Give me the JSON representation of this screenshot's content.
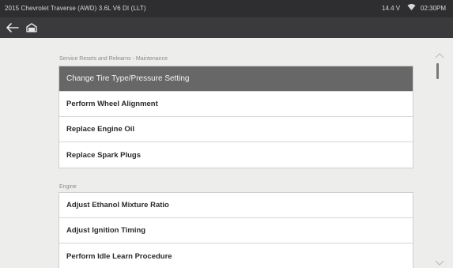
{
  "status_bar": {
    "vehicle": "2015 Chevrolet Traverse (AWD) 3.6L V6 DI (LLT)",
    "voltage": "14.4 V",
    "time": "02:30PM"
  },
  "sections": [
    {
      "header": "Service Resets and Relearns - Maintenance",
      "items": [
        {
          "label": "Change Tire Type/Pressure Setting",
          "selected": true
        },
        {
          "label": "Perform Wheel Alignment",
          "selected": false
        },
        {
          "label": "Replace Engine Oil",
          "selected": false
        },
        {
          "label": "Replace Spark Plugs",
          "selected": false
        }
      ]
    },
    {
      "header": "Engine",
      "items": [
        {
          "label": "Adjust Ethanol Mixture Ratio",
          "selected": false
        },
        {
          "label": "Adjust Ignition Timing",
          "selected": false
        },
        {
          "label": "Perform Idle Learn Procedure",
          "selected": false
        }
      ]
    }
  ],
  "colors": {
    "selected_row": "#676767",
    "background": "#ededeb",
    "status_bar": "#2e2e30"
  },
  "icons": {
    "back": "arrow-left-icon",
    "home": "home-icon",
    "wifi": "wifi-icon",
    "scroll_up": "chevron-up-icon",
    "scroll_down": "chevron-down-icon"
  }
}
